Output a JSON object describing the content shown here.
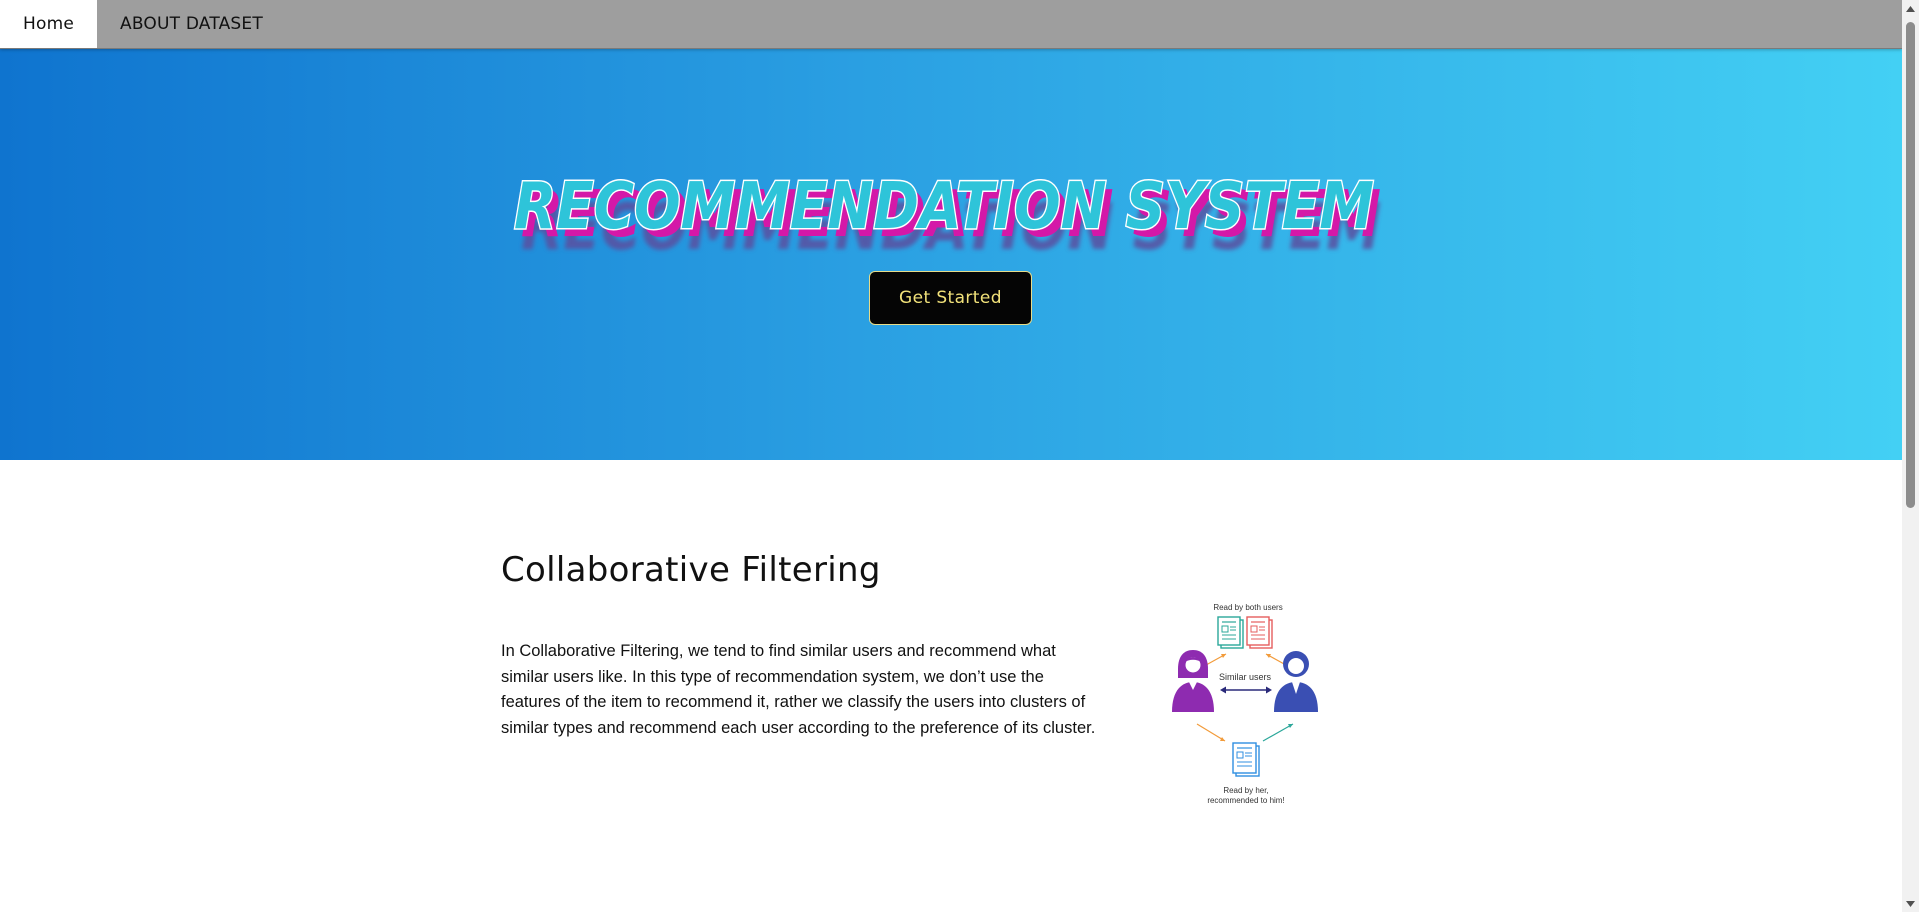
{
  "nav": {
    "tabs": [
      {
        "label": "Home",
        "active": true
      },
      {
        "label": "ABOUT DATASET",
        "active": false
      }
    ]
  },
  "hero": {
    "title": "RECOMMENDATION SYSTEM",
    "button_label": "Get Started",
    "gradient_start": "#0f74cf",
    "gradient_end": "#43d0f4",
    "title_fill_color": "#2ec4d9",
    "title_shadow_color": "#d418a8",
    "title_far_shadow_color": "#5a4fa0"
  },
  "section": {
    "title": "Collaborative Filtering",
    "paragraph": "In Collaborative Filtering, we tend to find similar users and recommend what similar users like. In this type of recommendation system, we don’t use the features of the item to recommend it, rather we classify the users into clusters of similar types and recommend each user according to the preference of its cluster."
  },
  "illustration": {
    "top_label": "Read by both users",
    "middle_label": "Similar users",
    "bottom_label_line1": "Read by her,",
    "bottom_label_line2": "recommended to him!",
    "icons": [
      "document-icon-teal",
      "document-icon-red",
      "woman-user-icon",
      "man-user-icon",
      "document-icon-blue"
    ],
    "colors": {
      "woman": "#8e2bb0",
      "man": "#3a4fb3",
      "doc_teal": "#2ba79a",
      "doc_red": "#e55d5d",
      "doc_blue": "#2f8fe0",
      "arrow_orange": "#f29b3a",
      "arrow_green": "#2ba79a",
      "arrow_navy": "#2a2a7a"
    }
  },
  "scrollbar": {
    "up_icon": "chevron-up-icon",
    "down_icon": "chevron-down-icon"
  }
}
